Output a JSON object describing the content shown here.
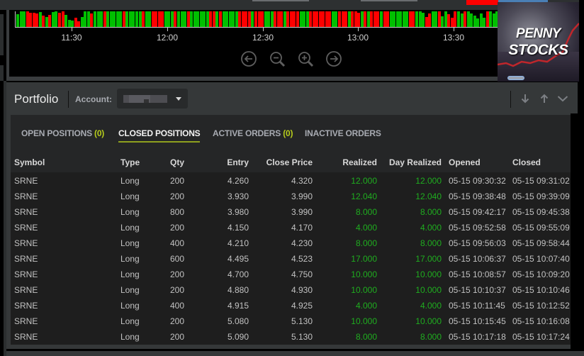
{
  "chart": {
    "time_ticks": [
      "11:30",
      "12:00",
      "12:30",
      "13:00",
      "13:30"
    ],
    "volume_bars": [
      {
        "c": "g",
        "h": 0.8
      },
      {
        "c": "g",
        "h": 1
      },
      {
        "c": "g",
        "h": 1
      },
      {
        "c": "r",
        "h": 1
      },
      {
        "c": "r",
        "h": 0.9
      },
      {
        "c": "r",
        "h": 0.9
      },
      {
        "c": "r",
        "h": 0.85
      },
      {
        "c": "g",
        "h": 0.95
      },
      {
        "c": "r",
        "h": 0.75
      },
      {
        "c": "g",
        "h": 0.65
      },
      {
        "c": "r",
        "h": 0.78
      },
      {
        "c": "g",
        "h": 0.95
      },
      {
        "c": "g",
        "h": 1
      },
      {
        "c": "r",
        "h": 0.9
      },
      {
        "c": "r",
        "h": 1
      },
      {
        "c": "g",
        "h": 0.78
      },
      {
        "c": "g",
        "h": 0.45
      },
      {
        "c": "g",
        "h": 0.4
      },
      {
        "c": "r",
        "h": 0.6
      },
      {
        "c": "r",
        "h": 0.35
      },
      {
        "c": "g",
        "h": 0.65
      },
      {
        "c": "g",
        "h": 1
      },
      {
        "c": "g",
        "h": 1
      },
      {
        "c": "r",
        "h": 0.88
      },
      {
        "c": "g",
        "h": 1
      },
      {
        "c": "g",
        "h": 1
      },
      {
        "c": "g",
        "h": 1
      },
      {
        "c": "r",
        "h": 1
      },
      {
        "c": "g",
        "h": 1
      },
      {
        "c": "g",
        "h": 1
      },
      {
        "c": "g",
        "h": 1
      },
      {
        "c": "g",
        "h": 1
      },
      {
        "c": "g",
        "h": 1
      },
      {
        "c": "r",
        "h": 1
      },
      {
        "c": "g",
        "h": 1
      },
      {
        "c": "g",
        "h": 1
      },
      {
        "c": "g",
        "h": 1
      },
      {
        "c": "g",
        "h": 1
      },
      {
        "c": "g",
        "h": 1
      },
      {
        "c": "r",
        "h": 1
      },
      {
        "c": "g",
        "h": 1
      },
      {
        "c": "g",
        "h": 1
      },
      {
        "c": "r",
        "h": 1
      },
      {
        "c": "r",
        "h": 1
      },
      {
        "c": "r",
        "h": 1
      },
      {
        "c": "r",
        "h": 1
      },
      {
        "c": "g",
        "h": 1
      },
      {
        "c": "g",
        "h": 1
      },
      {
        "c": "g",
        "h": 1
      },
      {
        "c": "r",
        "h": 1
      },
      {
        "c": "g",
        "h": 1
      },
      {
        "c": "g",
        "h": 1
      },
      {
        "c": "g",
        "h": 1
      },
      {
        "c": "r",
        "h": 1
      },
      {
        "c": "g",
        "h": 1
      },
      {
        "c": "g",
        "h": 1
      },
      {
        "c": "g",
        "h": 1
      },
      {
        "c": "g",
        "h": 1
      },
      {
        "c": "g",
        "h": 1
      },
      {
        "c": "g",
        "h": 1
      },
      {
        "c": "r",
        "h": 1
      },
      {
        "c": "r",
        "h": 1
      },
      {
        "c": "g",
        "h": 1
      },
      {
        "c": "r",
        "h": 1
      },
      {
        "c": "g",
        "h": 1
      },
      {
        "c": "g",
        "h": 1
      },
      {
        "c": "g",
        "h": 1
      },
      {
        "c": "g",
        "h": 1
      },
      {
        "c": "g",
        "h": 1
      },
      {
        "c": "r",
        "h": 1
      },
      {
        "c": "r",
        "h": 1
      },
      {
        "c": "r",
        "h": 1
      },
      {
        "c": "r",
        "h": 1
      },
      {
        "c": "g",
        "h": 1
      },
      {
        "c": "r",
        "h": 1
      },
      {
        "c": "r",
        "h": 1
      },
      {
        "c": "r",
        "h": 1
      },
      {
        "c": "g",
        "h": 1
      },
      {
        "c": "g",
        "h": 1
      },
      {
        "c": "g",
        "h": 1
      },
      {
        "c": "r",
        "h": 1
      },
      {
        "c": "r",
        "h": 1
      },
      {
        "c": "r",
        "h": 1
      },
      {
        "c": "g",
        "h": 1
      },
      {
        "c": "r",
        "h": 1
      },
      {
        "c": "r",
        "h": 1
      },
      {
        "c": "r",
        "h": 1
      },
      {
        "c": "r",
        "h": 1
      },
      {
        "c": "g",
        "h": 1
      },
      {
        "c": "g",
        "h": 1
      },
      {
        "c": "g",
        "h": 1
      },
      {
        "c": "r",
        "h": 1
      },
      {
        "c": "r",
        "h": 1
      },
      {
        "c": "r",
        "h": 1
      },
      {
        "c": "r",
        "h": 1
      },
      {
        "c": "r",
        "h": 1
      },
      {
        "c": "r",
        "h": 1
      },
      {
        "c": "r",
        "h": 1
      },
      {
        "c": "g",
        "h": 1
      },
      {
        "c": "g",
        "h": 1
      },
      {
        "c": "r",
        "h": 1
      },
      {
        "c": "r",
        "h": 1
      },
      {
        "c": "r",
        "h": 1
      },
      {
        "c": "g",
        "h": 1
      },
      {
        "c": "r",
        "h": 1
      },
      {
        "c": "r",
        "h": 1
      },
      {
        "c": "r",
        "h": 0.9
      },
      {
        "c": "g",
        "h": 1
      },
      {
        "c": "r",
        "h": 1
      },
      {
        "c": "g",
        "h": 1
      },
      {
        "c": "r",
        "h": 1
      },
      {
        "c": "r",
        "h": 1
      },
      {
        "c": "r",
        "h": 1
      },
      {
        "c": "g",
        "h": 1
      },
      {
        "c": "r",
        "h": 1
      },
      {
        "c": "r",
        "h": 1
      },
      {
        "c": "g",
        "h": 1
      },
      {
        "c": "g",
        "h": 1
      },
      {
        "c": "g",
        "h": 1
      },
      {
        "c": "g",
        "h": 1
      },
      {
        "c": "g",
        "h": 1
      },
      {
        "c": "g",
        "h": 1
      },
      {
        "c": "r",
        "h": 1
      },
      {
        "c": "r",
        "h": 1
      },
      {
        "c": "g",
        "h": 1
      },
      {
        "c": "g",
        "h": 1
      },
      {
        "c": "g",
        "h": 0.9
      },
      {
        "c": "r",
        "h": 0.65
      },
      {
        "c": "r",
        "h": 0.85
      },
      {
        "c": "g",
        "h": 1
      },
      {
        "c": "g",
        "h": 1
      },
      {
        "c": "r",
        "h": 1
      },
      {
        "c": "g",
        "h": 0.7
      },
      {
        "c": "g",
        "h": 1
      },
      {
        "c": "r",
        "h": 0.8
      },
      {
        "c": "r",
        "h": 0.6
      },
      {
        "c": "r",
        "h": 1
      },
      {
        "c": "g",
        "h": 1
      },
      {
        "c": "g",
        "h": 0.85
      },
      {
        "c": "r",
        "h": 1
      },
      {
        "c": "g",
        "h": 1
      },
      {
        "c": "g",
        "h": 0.85
      },
      {
        "c": "g",
        "h": 0.75
      },
      {
        "c": "g",
        "h": 0.55
      },
      {
        "c": "g",
        "h": 0.85
      },
      {
        "c": "g",
        "h": 0.6
      },
      {
        "c": "r",
        "h": 1
      },
      {
        "c": "g",
        "h": 1
      },
      {
        "c": "g",
        "h": 0.85
      },
      {
        "c": "g",
        "h": 1
      },
      {
        "c": "r",
        "h": 0.85
      },
      {
        "c": "g",
        "h": 1
      },
      {
        "c": "r",
        "h": 1
      },
      {
        "c": "g",
        "h": 0.85
      }
    ],
    "colors": {
      "up": "#00c000",
      "down": "#ff0000"
    },
    "nav": [
      "scroll-left",
      "zoom-out",
      "zoom-in",
      "scroll-right"
    ]
  },
  "logo": {
    "line1": "PENNY",
    "line2": "STOCKS"
  },
  "portfolio": {
    "title": "Portfolio",
    "account_label": "Account:",
    "account_value_redacted": true,
    "tabs": [
      {
        "label": "OPEN POSITIONS",
        "count": "(0)",
        "active": false
      },
      {
        "label": "CLOSED POSITIONS",
        "count": "",
        "active": true
      },
      {
        "label": "ACTIVE ORDERS",
        "count": "(0)",
        "active": false
      },
      {
        "label": "INACTIVE ORDERS",
        "count": "",
        "active": false
      }
    ],
    "columns": [
      "Symbol",
      "Type",
      "Qty",
      "Entry",
      "Close Price",
      "Realized",
      "Day Realized",
      "Opened",
      "Closed"
    ],
    "rows": [
      [
        "SRNE",
        "Long",
        "200",
        "4.260",
        "4.320",
        "12.000",
        "12.000",
        "05-15 09:30:32",
        "05-15 09:31:02"
      ],
      [
        "SRNE",
        "Long",
        "200",
        "3.930",
        "3.990",
        "12.040",
        "12.040",
        "05-15 09:38:48",
        "05-15 09:39:09"
      ],
      [
        "SRNE",
        "Long",
        "800",
        "3.980",
        "3.990",
        "8.000",
        "8.000",
        "05-15 09:42:17",
        "05-15 09:45:38"
      ],
      [
        "SRNE",
        "Long",
        "200",
        "4.150",
        "4.170",
        "4.000",
        "4.000",
        "05-15 09:52:58",
        "05-15 09:55:09"
      ],
      [
        "SRNE",
        "Long",
        "400",
        "4.210",
        "4.230",
        "8.000",
        "8.000",
        "05-15 09:56:03",
        "05-15 09:58:44"
      ],
      [
        "SRNE",
        "Long",
        "600",
        "4.495",
        "4.523",
        "17.000",
        "17.000",
        "05-15 10:06:37",
        "05-15 10:07:40"
      ],
      [
        "SRNE",
        "Long",
        "200",
        "4.700",
        "4.750",
        "10.000",
        "10.000",
        "05-15 10:08:57",
        "05-15 10:09:20"
      ],
      [
        "SRNE",
        "Long",
        "200",
        "4.880",
        "4.930",
        "10.000",
        "10.000",
        "05-15 10:10:37",
        "05-15 10:10:46"
      ],
      [
        "SRNE",
        "Long",
        "400",
        "4.915",
        "4.925",
        "4.000",
        "4.000",
        "05-15 10:11:45",
        "05-15 10:12:52"
      ],
      [
        "SRNE",
        "Long",
        "200",
        "5.080",
        "5.130",
        "10.000",
        "10.000",
        "05-15 10:15:45",
        "05-15 10:16:08"
      ],
      [
        "SRNE",
        "Long",
        "200",
        "5.090",
        "5.130",
        "8.000",
        "8.000",
        "05-15 10:17:18",
        "05-15 10:17:24"
      ]
    ],
    "colors": {
      "positive": "#1fad1f",
      "accent": "#b6cc1c"
    }
  }
}
